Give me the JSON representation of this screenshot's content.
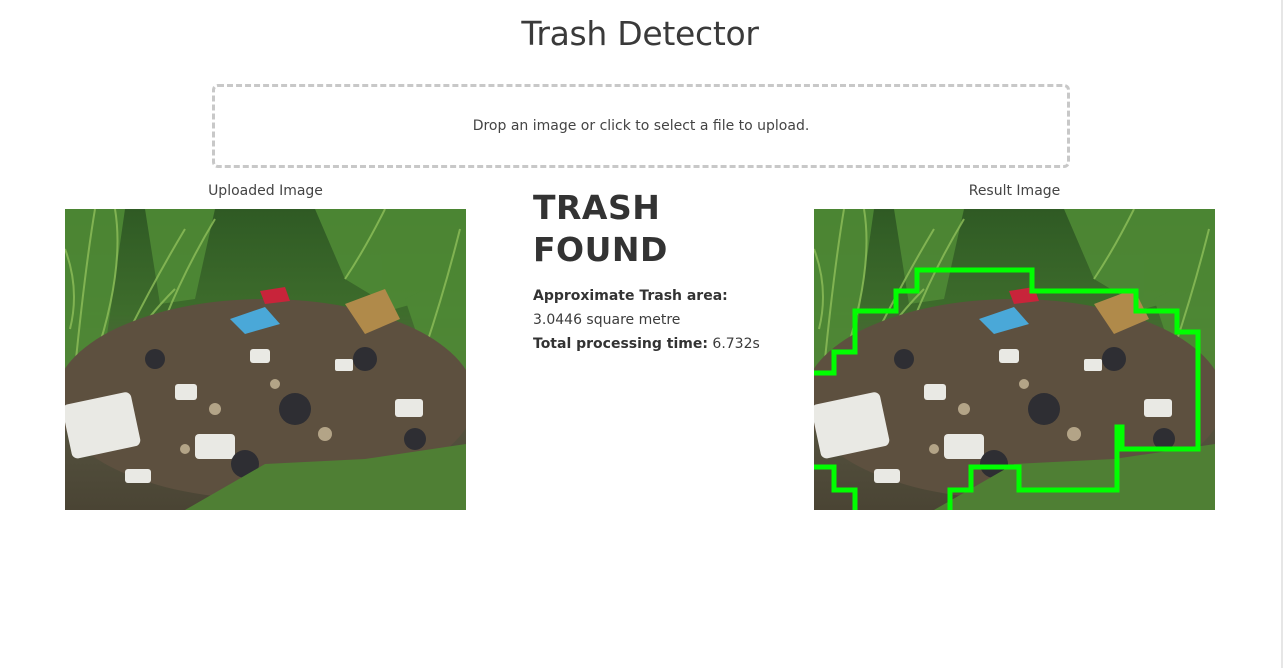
{
  "page": {
    "title": "Trash Detector"
  },
  "upload": {
    "prompt": "Drop an image or click to select a file to upload."
  },
  "uploaded_panel": {
    "caption": "Uploaded Image"
  },
  "result_panel": {
    "caption": "Result Image"
  },
  "result": {
    "heading": "TRASH FOUND",
    "area_label": "Approximate Trash area:",
    "area_value": "3.0446 square metre",
    "time_label": "Total processing time:",
    "time_value": "6.732s"
  },
  "colors": {
    "outline": "#00ff00",
    "grass": "#3f7a2c",
    "debris": "#6b5a45"
  },
  "icons": {
    "dropzone": "upload-dropzone"
  }
}
